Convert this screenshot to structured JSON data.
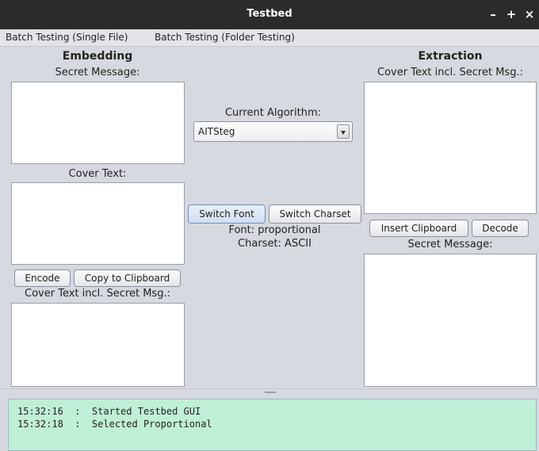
{
  "window": {
    "title": "Testbed",
    "minimize": "–",
    "maximize": "+",
    "close": "×"
  },
  "menu": {
    "items": [
      "Batch Testing (Single File)",
      "Batch Testing (Folder Testing)"
    ]
  },
  "embedding": {
    "heading": "Embedding",
    "secret_label": "Secret Message:",
    "cover_label": "Cover Text:",
    "encode_button": "Encode",
    "copy_button": "Copy to Clipboard",
    "cover_incl_label": "Cover Text incl. Secret Msg.:",
    "secret_value": "",
    "cover_value": "",
    "cover_incl_value": ""
  },
  "center": {
    "algorithm_label": "Current Algorithm:",
    "algorithm_value": "AITSteg",
    "switch_font_button": "Switch Font",
    "switch_charset_button": "Switch Charset",
    "font_status": "Font: proportional",
    "charset_status": "Charset: ASCII"
  },
  "extraction": {
    "heading": "Extraction",
    "cover_incl_label": "Cover Text incl. Secret Msg.:",
    "insert_button": "Insert Clipboard",
    "decode_button": "Decode",
    "secret_label": "Secret Message:",
    "cover_incl_value": "",
    "secret_value": ""
  },
  "log": {
    "lines": [
      "15:32:16  :  Started Testbed GUI",
      "15:32:18  :  Selected Proportional"
    ]
  }
}
